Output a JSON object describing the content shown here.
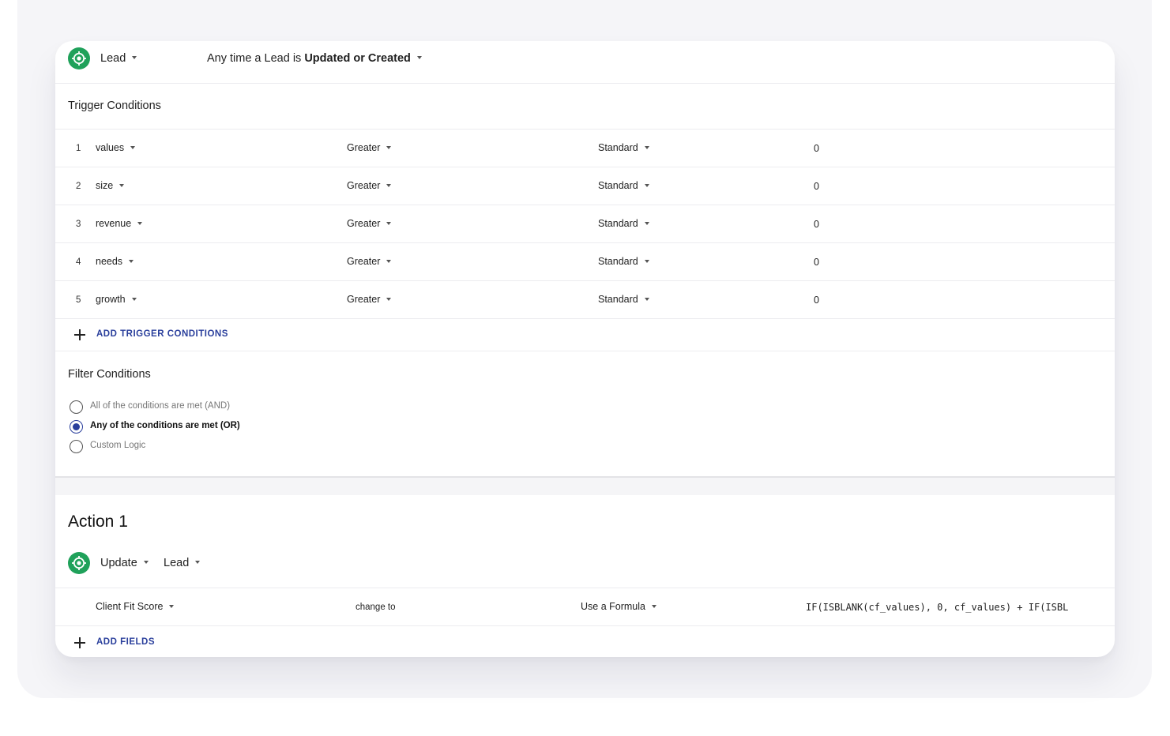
{
  "trigger": {
    "object_label": "Lead",
    "event_prefix": "Any time a Lead is",
    "event_value": "Updated or Created"
  },
  "trigger_conditions": {
    "title": "Trigger Conditions",
    "rows": [
      {
        "num": "1",
        "field": "values",
        "operator": "Greater",
        "type": "Standard",
        "value": "0"
      },
      {
        "num": "2",
        "field": "size",
        "operator": "Greater",
        "type": "Standard",
        "value": "0"
      },
      {
        "num": "3",
        "field": "revenue",
        "operator": "Greater",
        "type": "Standard",
        "value": "0"
      },
      {
        "num": "4",
        "field": "needs",
        "operator": "Greater",
        "type": "Standard",
        "value": "0"
      },
      {
        "num": "5",
        "field": "growth",
        "operator": "Greater",
        "type": "Standard",
        "value": "0"
      }
    ],
    "add_label": "ADD TRIGGER CONDITIONS"
  },
  "filter_conditions": {
    "title": "Filter Conditions",
    "options": [
      {
        "label": "All of the conditions are met (AND)",
        "selected": false
      },
      {
        "label": "Any of the conditions are met (OR)",
        "selected": true
      },
      {
        "label": "Custom Logic",
        "selected": false
      }
    ]
  },
  "action": {
    "title": "Action 1",
    "verb": "Update",
    "object": "Lead",
    "field_row": {
      "field": "Client Fit Score",
      "change_label": "change to",
      "mode": "Use a Formula",
      "formula": "IF(ISBLANK(cf_values), 0, cf_values) +  IF(ISBL"
    },
    "add_label": "ADD FIELDS"
  },
  "colors": {
    "accent": "#2a3f9c",
    "object_icon": "#1fa15a",
    "backdrop": "#f5f5f8"
  },
  "icons": {
    "object": "target-icon",
    "add": "plus-icon",
    "dropdown": "caret-down-icon"
  }
}
